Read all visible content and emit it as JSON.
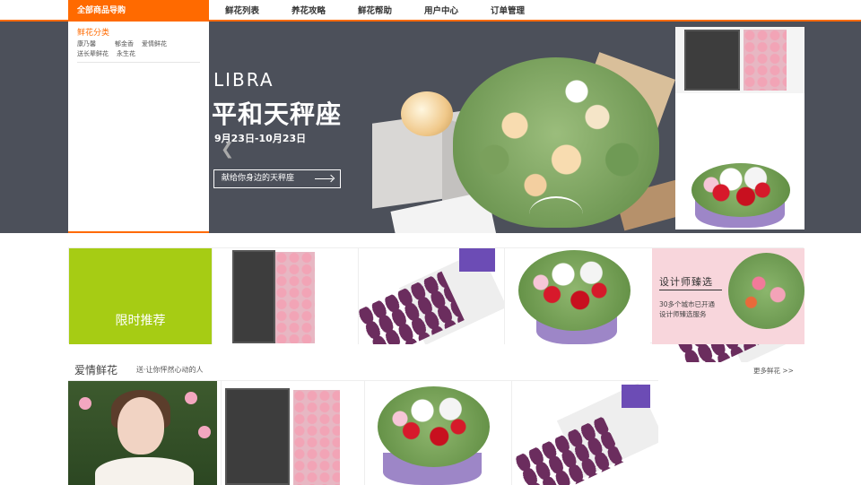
{
  "nav": {
    "all_products": "全部商品导购",
    "links": [
      "鲜花列表",
      "养花攻略",
      "鲜花帮助",
      "用户中心",
      "订单管理"
    ]
  },
  "side_menu": {
    "category_title": "鲜花分类",
    "items": [
      "康乃馨",
      "郁金香",
      "爱情鲜花",
      "送长辈鲜花",
      "永生花"
    ]
  },
  "banner": {
    "title_en": "LIBRA",
    "title_cn": "平和天秤座",
    "dates": "9月23日-10月23日",
    "cta": "献给你身边的天秤座",
    "prev_icon": "chevron-left-icon",
    "slide_count": 4,
    "active_slide": 2,
    "thumbnails": [
      "rose-box",
      "lily-bouquet",
      "tulip-bouquet"
    ]
  },
  "promo": {
    "label": "限时推荐",
    "products": [
      "rose-box",
      "tulip-bouquet",
      "lily-bouquet"
    ],
    "designer": {
      "title": "设计师臻选",
      "line1": "30多个城市已开通",
      "line2": "设计师臻选服务"
    }
  },
  "love_section": {
    "title": "爱情鲜花",
    "subtitle": "送·让你怦然心动的人",
    "more": "更多鲜花 >>",
    "products": [
      "model-photo",
      "rose-box",
      "lily-bouquet",
      "tulip-bouquet"
    ]
  },
  "colors": {
    "accent": "#ff6a00",
    "promo_green": "#a6cc14",
    "banner_bg": "#4c505a",
    "designer_pink": "#f8d6dc"
  }
}
